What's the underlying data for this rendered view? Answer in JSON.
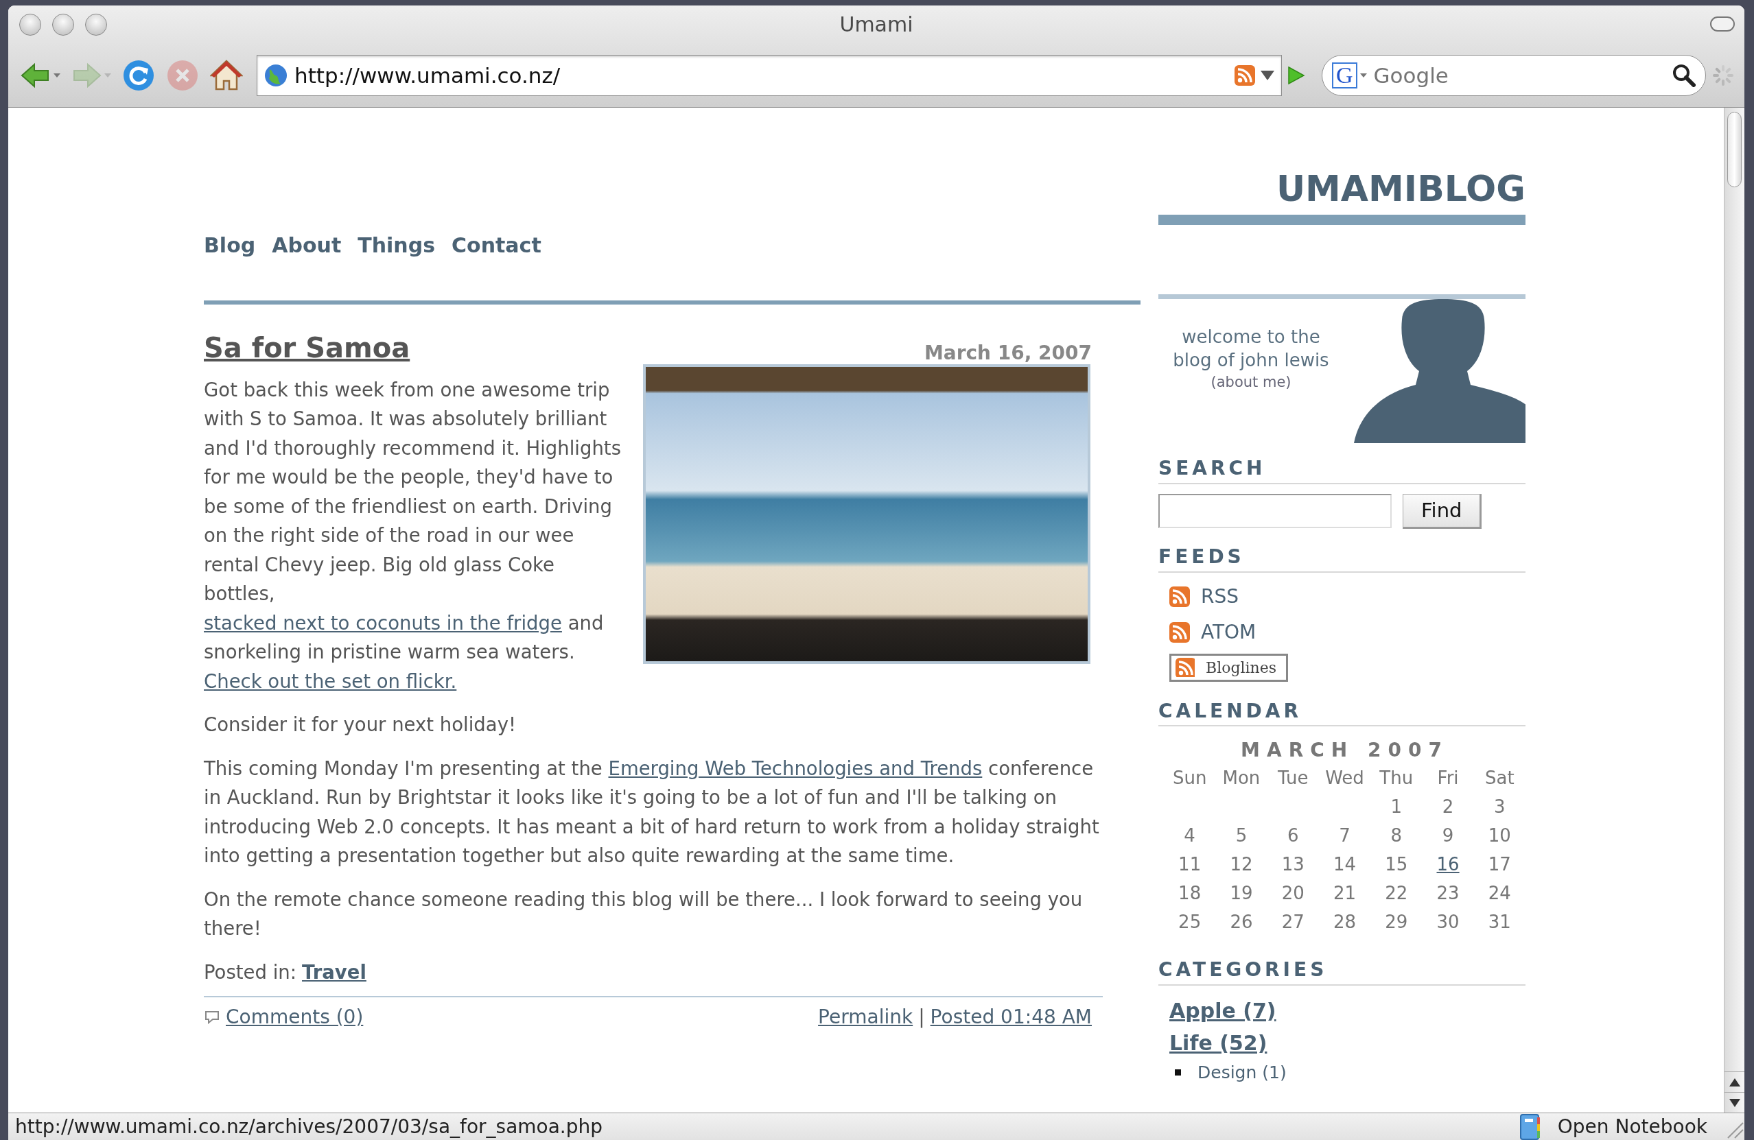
{
  "window": {
    "title": "Umami"
  },
  "toolbar": {
    "buttons": [
      {
        "kind": "back",
        "disabled": false
      },
      {
        "kind": "forward",
        "disabled": true
      },
      {
        "kind": "reload",
        "disabled": false
      },
      {
        "kind": "stop",
        "disabled": true
      },
      {
        "kind": "home",
        "disabled": false
      }
    ],
    "address": {
      "value": "http://www.umami.co.nz/"
    },
    "search": {
      "engine_letter": "G",
      "placeholder": "Google"
    }
  },
  "blog": {
    "title": "UMAMIBLOG",
    "nav": [
      "Blog",
      "About",
      "Things",
      "Contact"
    ],
    "post": {
      "title": "Sa for Samoa",
      "date": "March 16, 2007",
      "paragraphs": [
        {
          "segments": [
            {
              "kind": "text",
              "text": "Got back this week from one awesome trip with S to Samoa. It was absolutely brilliant and I'd thoroughly recommend it. Highlights for me would be the people, they'd have to be some of the friendliest on earth. Driving on the right side of the road in our wee rental Chevy jeep. Big old glass Coke bottles, "
            },
            {
              "kind": "link",
              "text": "stacked next to coconuts in the fridge"
            },
            {
              "kind": "text",
              "text": " and snorkeling in pristine warm sea waters. "
            },
            {
              "kind": "link",
              "text": "Check out the set on flickr."
            }
          ]
        },
        {
          "segments": [
            {
              "kind": "text",
              "text": "Consider it for your next holiday!"
            }
          ]
        },
        {
          "segments": [
            {
              "kind": "text",
              "text": "This coming Monday I'm presenting at the "
            },
            {
              "kind": "link",
              "text": "Emerging Web Technologies and Trends"
            },
            {
              "kind": "text",
              "text": " conference in Auckland. Run by Brightstar it looks like it's going to be a lot of fun and I'll be talking on introducing Web 2.0 concepts. It has meant a bit of hard return to work from a holiday straight into getting a presentation together but also quite rewarding at the same time."
            }
          ]
        },
        {
          "segments": [
            {
              "kind": "text",
              "text": "On the remote chance someone reading this blog will be there... I look forward to seeing you there!"
            }
          ]
        }
      ],
      "posted_in": {
        "label": "Posted in:",
        "category": "Travel"
      },
      "footer": {
        "comments": "Comments (0)",
        "permalink": "Permalink",
        "separator": "|",
        "posted": "Posted 01:48 AM"
      }
    },
    "sidebar": {
      "welcome": "welcome to the blog of john lewis",
      "about": "(about me)",
      "search": {
        "heading": "SEARCH",
        "button": "Find"
      },
      "feeds": {
        "heading": "FEEDS",
        "items": [
          {
            "kind": "link",
            "label": "RSS"
          },
          {
            "kind": "link",
            "label": "ATOM"
          },
          {
            "kind": "badge",
            "label": "Bloglines"
          }
        ]
      },
      "calendar": {
        "heading": "CALENDAR",
        "caption": "MARCH 2007",
        "weekdays": [
          "Sun",
          "Mon",
          "Tue",
          "Wed",
          "Thu",
          "Fri",
          "Sat"
        ],
        "weeks": [
          [
            {
              "day": "1",
              "linked": false
            },
            {
              "day": "2",
              "linked": false
            },
            {
              "day": "3",
              "linked": false
            }
          ],
          [
            {
              "day": "4",
              "linked": false
            },
            {
              "day": "5",
              "linked": false
            },
            {
              "day": "6",
              "linked": false
            },
            {
              "day": "7",
              "linked": false
            },
            {
              "day": "8",
              "linked": false
            },
            {
              "day": "9",
              "linked": false
            },
            {
              "day": "10",
              "linked": false
            }
          ],
          [
            {
              "day": "11",
              "linked": false
            },
            {
              "day": "12",
              "linked": false
            },
            {
              "day": "13",
              "linked": false
            },
            {
              "day": "14",
              "linked": false
            },
            {
              "day": "15",
              "linked": false
            },
            {
              "day": "16",
              "linked": true
            },
            {
              "day": "17",
              "linked": false
            }
          ],
          [
            {
              "day": "18",
              "linked": false
            },
            {
              "day": "19",
              "linked": false
            },
            {
              "day": "20",
              "linked": false
            },
            {
              "day": "21",
              "linked": false
            },
            {
              "day": "22",
              "linked": false
            },
            {
              "day": "23",
              "linked": false
            },
            {
              "day": "24",
              "linked": false
            }
          ],
          [
            {
              "day": "25",
              "linked": false
            },
            {
              "day": "26",
              "linked": false
            },
            {
              "day": "27",
              "linked": false
            },
            {
              "day": "28",
              "linked": false
            },
            {
              "day": "29",
              "linked": false
            },
            {
              "day": "30",
              "linked": false
            },
            {
              "day": "31",
              "linked": false
            }
          ]
        ]
      },
      "categories": {
        "heading": "CATEGORIES",
        "items": [
          {
            "label": "Apple (7)"
          },
          {
            "label": "Life (52)",
            "children": [
              {
                "label": "Design (1)"
              }
            ]
          }
        ]
      }
    }
  },
  "status_bar": {
    "url": "http://www.umami.co.nz/archives/2007/03/sa_for_samoa.php",
    "notebook": "Open Notebook"
  }
}
